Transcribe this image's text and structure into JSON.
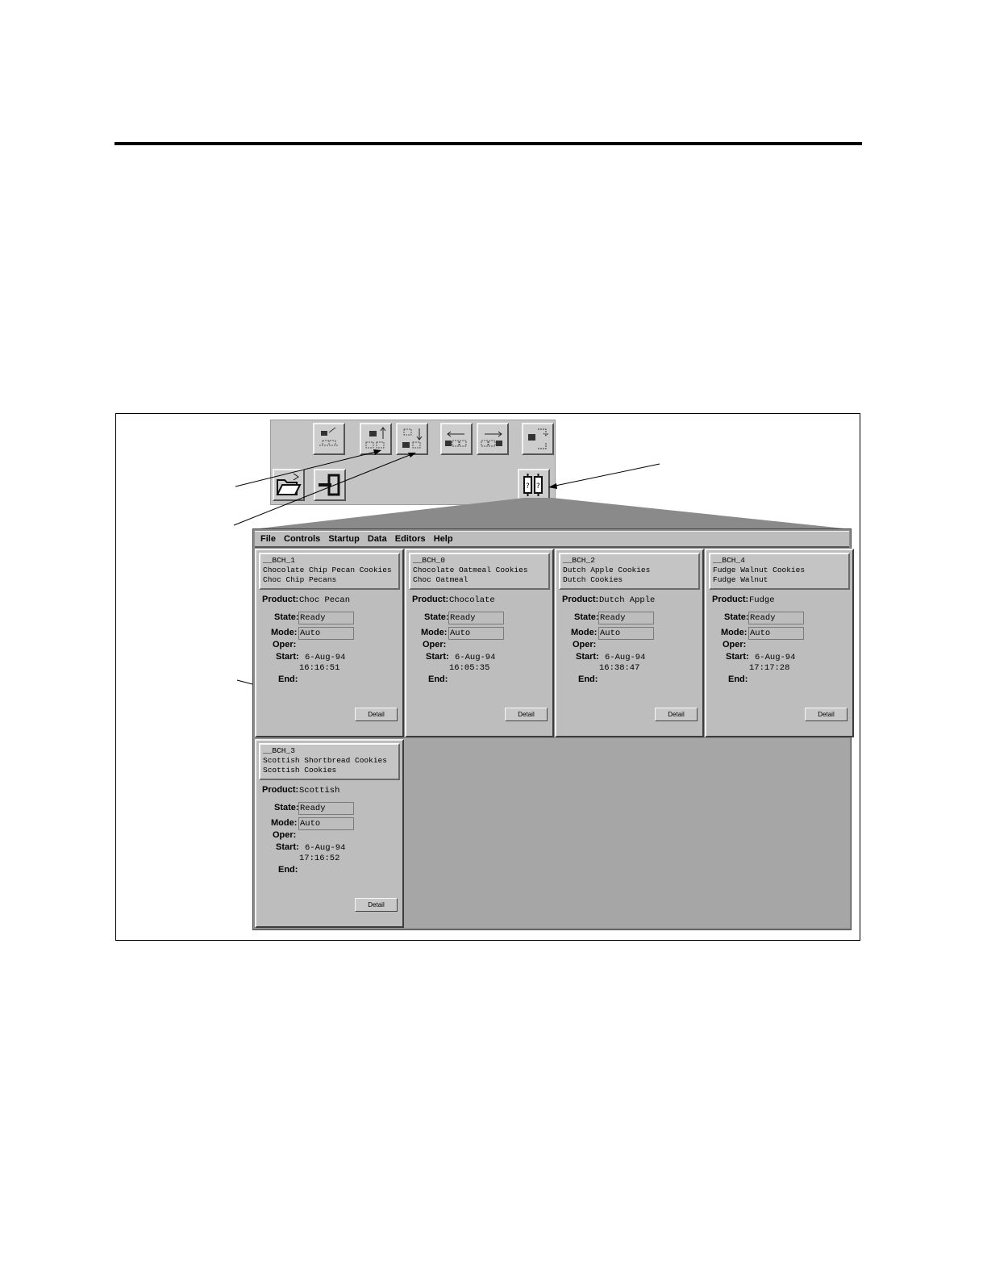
{
  "menu": [
    "File",
    "Controls",
    "Startup",
    "Data",
    "Editors",
    "Help"
  ],
  "toolbar_icons": {
    "row1": [
      "batch-tree-icon",
      "move-up-icon",
      "move-down-icon",
      "move-left-icon",
      "move-right-icon",
      "refresh-icon"
    ],
    "row2": [
      "open-folder-icon",
      "exit-icon"
    ],
    "batch_list": "batch-list-icon"
  },
  "labels": {
    "product": "Product:",
    "state": "State:",
    "mode": "Mode:",
    "oper": "Oper:",
    "start": "Start:",
    "end": "End:",
    "detail": "Detail"
  },
  "batches": [
    {
      "id": "__BCH_1",
      "desc1": "Chocolate Chip Pecan Cookies",
      "desc2": "Choc Chip Pecans",
      "product": "Choc Pecan",
      "state": "Ready",
      "mode": "Auto",
      "oper": "",
      "start_date": "6-Aug-94",
      "start_time": "16:16:51",
      "end": ""
    },
    {
      "id": "__BCH_0",
      "desc1": "Chocolate Oatmeal Cookies",
      "desc2": "Choc Oatmeal",
      "product": "Chocolate",
      "state": "Ready",
      "mode": "Auto",
      "oper": "",
      "start_date": "6-Aug-94",
      "start_time": "16:05:35",
      "end": ""
    },
    {
      "id": "__BCH_2",
      "desc1": "Dutch Apple Cookies",
      "desc2": "Dutch Cookies",
      "product": "Dutch Apple",
      "state": "Ready",
      "mode": "Auto",
      "oper": "",
      "start_date": "6-Aug-94",
      "start_time": "16:38:47",
      "end": ""
    },
    {
      "id": "__BCH_4",
      "desc1": "Fudge Walnut Cookies",
      "desc2": "Fudge Walnut",
      "product": "Fudge",
      "state": "Ready",
      "mode": "Auto",
      "oper": "",
      "start_date": "6-Aug-94",
      "start_time": "17:17:28",
      "end": ""
    },
    {
      "id": "__BCH_3",
      "desc1": "Scottish Shortbread Cookies",
      "desc2": "Scottish Cookies",
      "product": "Scottish",
      "state": "Ready",
      "mode": "Auto",
      "oper": "",
      "start_date": "6-Aug-94",
      "start_time": "17:16:52",
      "end": ""
    }
  ]
}
